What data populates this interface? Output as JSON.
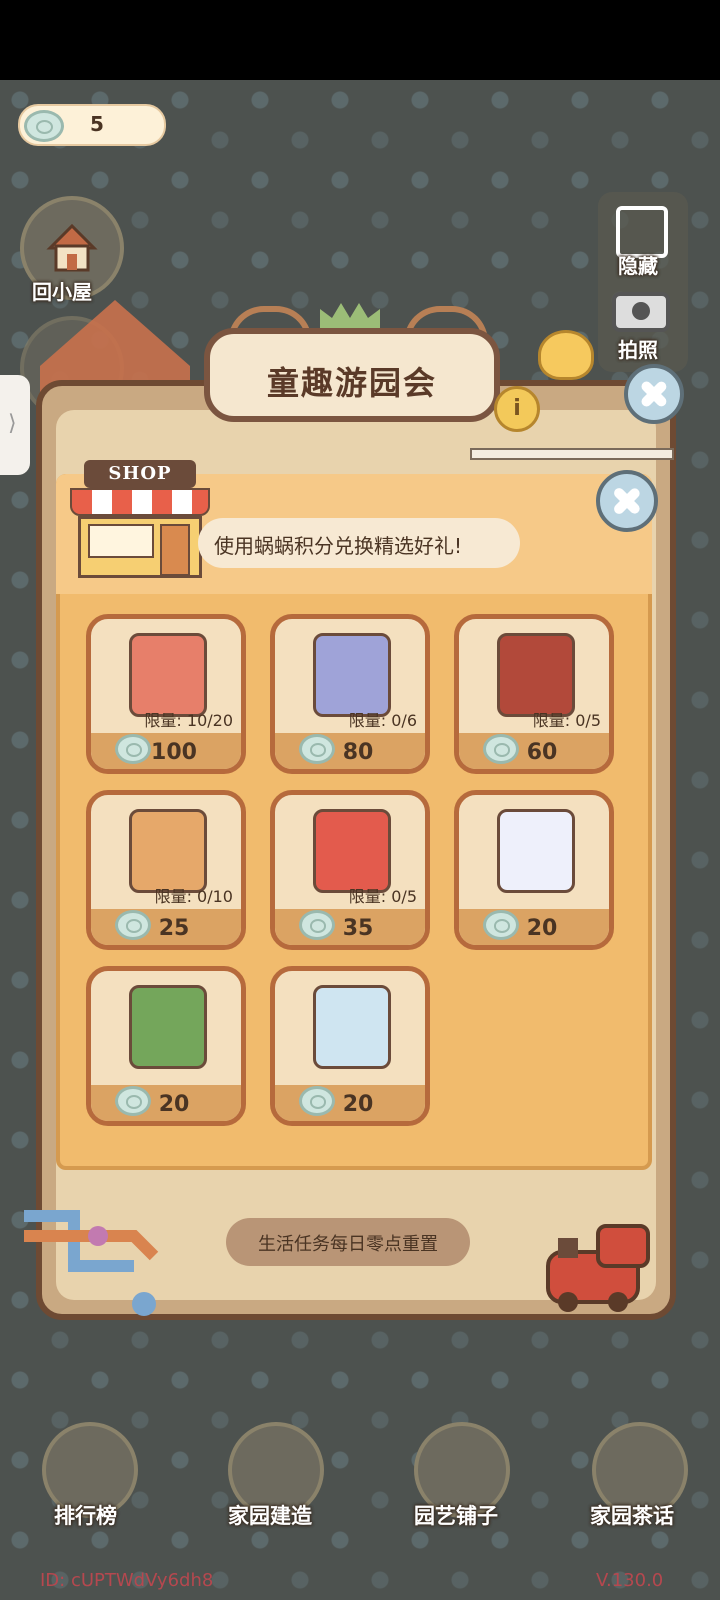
{
  "currency": {
    "value": "5"
  },
  "left_menu": [
    {
      "label": "回小屋"
    }
  ],
  "right_menu": [
    {
      "label": "隐藏"
    },
    {
      "label": "拍照"
    }
  ],
  "dialog": {
    "title": "童趣游园会",
    "info_icon": "i",
    "shop_sign": "SHOP",
    "subtitle": "使用蜗蜗积分兑换精选好礼!",
    "items": [
      {
        "limit": "限量: 10/20",
        "price": "100",
        "art_color": "#e77f6a"
      },
      {
        "limit": "限量: 0/6",
        "price": "80",
        "art_color": "#9fa3d8"
      },
      {
        "limit": "限量: 0/5",
        "price": "60",
        "art_color": "#b2493a"
      },
      {
        "limit": "限量: 0/10",
        "price": "25",
        "art_color": "#e6a86a"
      },
      {
        "limit": "限量: 0/5",
        "price": "35",
        "art_color": "#e35b4d"
      },
      {
        "limit": "",
        "price": "20",
        "art_color": "#eef0fb"
      },
      {
        "limit": "",
        "price": "20",
        "art_color": "#74a65b"
      },
      {
        "limit": "",
        "price": "20",
        "art_color": "#cfe5f1"
      }
    ],
    "reset_notice": "生活任务每日零点重置"
  },
  "bottom_nav": [
    {
      "label": "排行榜"
    },
    {
      "label": "家园建造"
    },
    {
      "label": "园艺铺子"
    },
    {
      "label": "家园茶话"
    }
  ],
  "footer": {
    "id": "ID: cUPTWdVy6dh8",
    "version": "V.130.0"
  }
}
